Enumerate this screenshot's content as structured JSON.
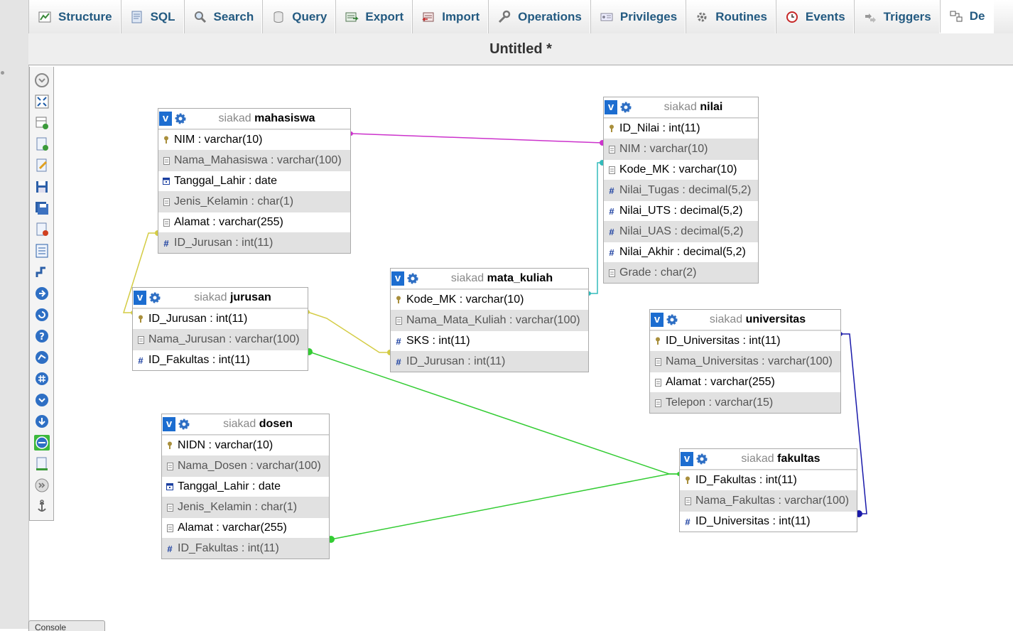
{
  "tabs": [
    {
      "label": "Structure",
      "icon": "structure-icon"
    },
    {
      "label": "SQL",
      "icon": "sql-icon"
    },
    {
      "label": "Search",
      "icon": "search-icon"
    },
    {
      "label": "Query",
      "icon": "query-icon"
    },
    {
      "label": "Export",
      "icon": "export-icon"
    },
    {
      "label": "Import",
      "icon": "import-icon"
    },
    {
      "label": "Operations",
      "icon": "operations-icon"
    },
    {
      "label": "Privileges",
      "icon": "privileges-icon"
    },
    {
      "label": "Routines",
      "icon": "routines-icon"
    },
    {
      "label": "Events",
      "icon": "events-icon"
    },
    {
      "label": "Triggers",
      "icon": "triggers-icon"
    },
    {
      "label": "De",
      "icon": "designer-icon",
      "active": true
    }
  ],
  "page_title": "Untitled *",
  "toolbar_icons": [
    "show-all-icon",
    "toggle-fullscreen-icon",
    "add-tables-icon",
    "new-page-icon",
    "open-page-icon",
    "save-page-icon",
    "save-as-icon",
    "delete-pages-icon",
    "create-table-icon",
    "create-relation-icon",
    "choose-column-icon",
    "reload-icon",
    "help-icon",
    "angular-links-icon",
    "snap-to-grid-icon",
    "small-big-all-icon",
    "toggle-small-big-icon",
    "relation-lines-icon",
    "export-schema-icon",
    "move-menu-icon",
    "pin-text-icon"
  ],
  "tables": {
    "mahasiswa": {
      "db": "siakad",
      "name": "mahasiswa",
      "columns": [
        {
          "name": "NIM",
          "type": "varchar(10)",
          "icon": "key"
        },
        {
          "name": "Nama_Mahasiswa",
          "type": "varchar(100)",
          "icon": "text"
        },
        {
          "name": "Tanggal_Lahir",
          "type": "date",
          "icon": "date"
        },
        {
          "name": "Jenis_Kelamin",
          "type": "char(1)",
          "icon": "text"
        },
        {
          "name": "Alamat",
          "type": "varchar(255)",
          "icon": "text"
        },
        {
          "name": "ID_Jurusan",
          "type": "int(11)",
          "icon": "number"
        }
      ]
    },
    "nilai": {
      "db": "siakad",
      "name": "nilai",
      "columns": [
        {
          "name": "ID_Nilai",
          "type": "int(11)",
          "icon": "key"
        },
        {
          "name": "NIM",
          "type": "varchar(10)",
          "icon": "text"
        },
        {
          "name": "Kode_MK",
          "type": "varchar(10)",
          "icon": "text"
        },
        {
          "name": "Nilai_Tugas",
          "type": "decimal(5,2)",
          "icon": "number"
        },
        {
          "name": "Nilai_UTS",
          "type": "decimal(5,2)",
          "icon": "number"
        },
        {
          "name": "Nilai_UAS",
          "type": "decimal(5,2)",
          "icon": "number"
        },
        {
          "name": "Nilai_Akhir",
          "type": "decimal(5,2)",
          "icon": "number"
        },
        {
          "name": "Grade",
          "type": "char(2)",
          "icon": "text"
        }
      ]
    },
    "jurusan": {
      "db": "siakad",
      "name": "jurusan",
      "columns": [
        {
          "name": "ID_Jurusan",
          "type": "int(11)",
          "icon": "key"
        },
        {
          "name": "Nama_Jurusan",
          "type": "varchar(100)",
          "icon": "text"
        },
        {
          "name": "ID_Fakultas",
          "type": "int(11)",
          "icon": "number"
        }
      ]
    },
    "mata_kuliah": {
      "db": "siakad",
      "name": "mata_kuliah",
      "columns": [
        {
          "name": "Kode_MK",
          "type": "varchar(10)",
          "icon": "key"
        },
        {
          "name": "Nama_Mata_Kuliah",
          "type": "varchar(100)",
          "icon": "text"
        },
        {
          "name": "SKS",
          "type": "int(11)",
          "icon": "number"
        },
        {
          "name": "ID_Jurusan",
          "type": "int(11)",
          "icon": "number"
        }
      ]
    },
    "universitas": {
      "db": "siakad",
      "name": "universitas",
      "columns": [
        {
          "name": "ID_Universitas",
          "type": "int(11)",
          "icon": "key"
        },
        {
          "name": "Nama_Universitas",
          "type": "varchar(100)",
          "icon": "text"
        },
        {
          "name": "Alamat",
          "type": "varchar(255)",
          "icon": "text"
        },
        {
          "name": "Telepon",
          "type": "varchar(15)",
          "icon": "text"
        }
      ]
    },
    "dosen": {
      "db": "siakad",
      "name": "dosen",
      "columns": [
        {
          "name": "NIDN",
          "type": "varchar(10)",
          "icon": "key"
        },
        {
          "name": "Nama_Dosen",
          "type": "varchar(100)",
          "icon": "text"
        },
        {
          "name": "Tanggal_Lahir",
          "type": "date",
          "icon": "date"
        },
        {
          "name": "Jenis_Kelamin",
          "type": "char(1)",
          "icon": "text"
        },
        {
          "name": "Alamat",
          "type": "varchar(255)",
          "icon": "text"
        },
        {
          "name": "ID_Fakultas",
          "type": "int(11)",
          "icon": "number"
        }
      ]
    },
    "fakultas": {
      "db": "siakad",
      "name": "fakultas",
      "columns": [
        {
          "name": "ID_Fakultas",
          "type": "int(11)",
          "icon": "key"
        },
        {
          "name": "Nama_Fakultas",
          "type": "varchar(100)",
          "icon": "text"
        },
        {
          "name": "ID_Universitas",
          "type": "int(11)",
          "icon": "number"
        }
      ]
    }
  },
  "relations": [
    {
      "from": "mahasiswa.NIM",
      "to": "nilai.NIM",
      "color": "#cc33cc"
    },
    {
      "from": "mata_kuliah.Kode_MK",
      "to": "nilai.Kode_MK",
      "color": "#33bbbb"
    },
    {
      "from": "jurusan.ID_Jurusan",
      "to": "mahasiswa.ID_Jurusan",
      "color": "#d4cc44"
    },
    {
      "from": "jurusan.ID_Jurusan",
      "to": "mata_kuliah.ID_Jurusan",
      "color": "#d4cc44"
    },
    {
      "from": "fakultas.ID_Fakultas",
      "to": "jurusan.ID_Fakultas",
      "color": "#33cc33"
    },
    {
      "from": "fakultas.ID_Fakultas",
      "to": "dosen.ID_Fakultas",
      "color": "#33cc33"
    },
    {
      "from": "universitas.ID_Universitas",
      "to": "fakultas.ID_Universitas",
      "color": "#1a1aaa"
    }
  ],
  "console_label": "Console"
}
